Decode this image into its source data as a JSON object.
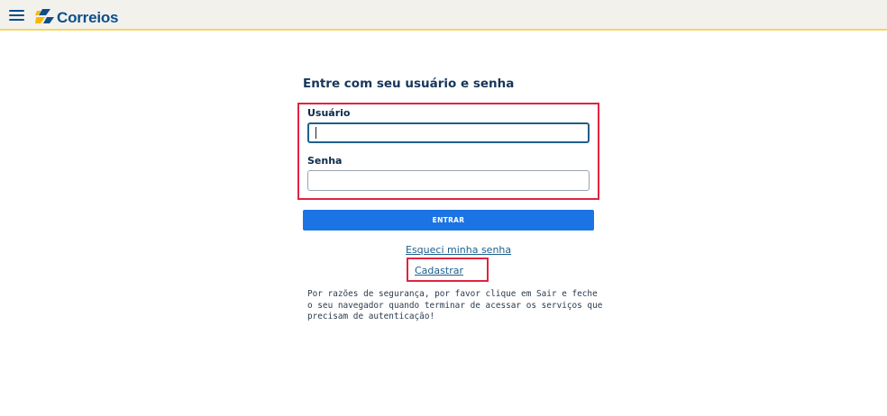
{
  "header": {
    "menu_icon": "hamburger-menu-icon",
    "logo_icon": "correios-logo-icon",
    "logo_text": "Correios",
    "colors": {
      "background": "#f3f1ec",
      "accent_line": "#f6d56a",
      "brand_blue": "#0b4f8a",
      "brand_yellow": "#f6b800"
    }
  },
  "login": {
    "title": "Entre com seu usuário e senha",
    "username_label": "Usuário",
    "username_value": "",
    "password_label": "Senha",
    "password_value": "",
    "submit_label": "ENTRAR",
    "forgot_link": "Esqueci minha senha",
    "register_link": "Cadastrar",
    "security_notice": "Por razões de segurança, por favor clique em Sair e feche o seu navegador quando terminar de acessar os serviços que precisam de autenticação!",
    "colors": {
      "button": "#1a74e4",
      "highlight": "#e0243f",
      "link": "#1b5e8c"
    }
  }
}
